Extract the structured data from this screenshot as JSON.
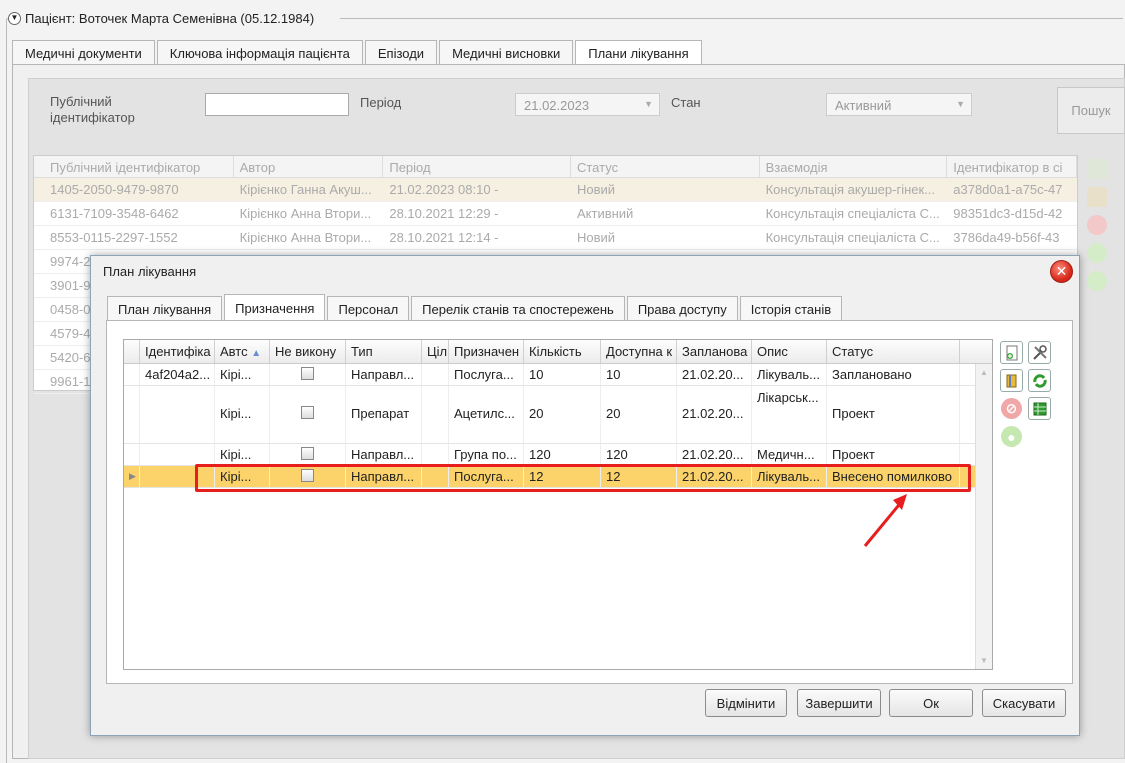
{
  "patient_header": {
    "title": "Пацієнт: Вοточек Марта Семенівна (05.12.1984)",
    "toggle_icon": "chevron-down-icon"
  },
  "main_tabs": [
    {
      "label": "Медичні документи",
      "active": false
    },
    {
      "label": "Ключова інформація пацієнта",
      "active": false
    },
    {
      "label": "Епізоди",
      "active": false
    },
    {
      "label": "Медичні висновки",
      "active": false
    },
    {
      "label": "Плани лікування",
      "active": true
    }
  ],
  "filters": {
    "public_id_label": "Публічний ідентифікатор",
    "public_id_value": "",
    "period_label": "Період",
    "period_value": "21.02.2023",
    "state_label": "Стан",
    "state_value": "Активний",
    "search_label": "Пошук"
  },
  "plans_grid": {
    "columns": [
      "Публічний ідентифікатор",
      "Автор",
      "Період",
      "Статус",
      "Взаємодія",
      "Ідентифікатор в сі"
    ],
    "rows": [
      [
        "1405-2050-9479-9870",
        "Кірієнко Ганна Акуш...",
        "21.02.2023 08:10 -",
        "Новий",
        "Консультація акушер-гінек...",
        "a378d0a1-a75c-47"
      ],
      [
        "6131-7109-3548-6462",
        "Кірієнко Анна Втори...",
        "28.10.2021 12:29 -",
        "Активний",
        "Консультація спеціаліста С...",
        "98351dc3-d15d-42"
      ],
      [
        "8553-0115-2297-1552",
        "Кірієнко Анна Втори...",
        "28.10.2021 12:14 -",
        "Новий",
        "Консультація спеціаліста С...",
        "3786da49-b56f-43"
      ],
      [
        "9974-2",
        "",
        "",
        "",
        "",
        ""
      ],
      [
        "3901-9",
        "",
        "",
        "",
        "",
        ""
      ],
      [
        "0458-0",
        "",
        "",
        "",
        "",
        ""
      ],
      [
        "4579-4",
        "",
        "",
        "",
        "",
        ""
      ],
      [
        "5420-6",
        "",
        "",
        "",
        "",
        ""
      ],
      [
        "9961-1",
        "",
        "",
        "",
        "",
        ""
      ]
    ]
  },
  "dialog": {
    "title": "План лікування",
    "tabs": [
      {
        "label": "План лікування",
        "active": false
      },
      {
        "label": "Призначення",
        "active": true
      },
      {
        "label": "Персонал",
        "active": false
      },
      {
        "label": "Перелік станів та спостережень",
        "active": false
      },
      {
        "label": "Права доступу",
        "active": false
      },
      {
        "label": "Історія станів",
        "active": false
      }
    ],
    "grid": {
      "columns": [
        "Ідентифіка",
        "Автс",
        "Не викону",
        "Тип",
        "Ціл",
        "Призначен",
        "Кількість",
        "Доступна к",
        "Запланова",
        "Опис",
        "Статус"
      ],
      "rows": [
        {
          "id": "4af204a2...",
          "author": "Кірі...",
          "type": "Направл...",
          "goal": "",
          "assigned": "Послуга...",
          "qty": "10",
          "avail": "10",
          "planned": "21.02.20...",
          "desc": "Лікуваль...",
          "status": "Заплановано"
        },
        {
          "id": "",
          "author": "Кірі...",
          "type": "Препарат",
          "goal": "",
          "assigned": "Ацетилс...",
          "qty": "20",
          "avail": "20",
          "planned": "21.02.20...",
          "desc": "Лікарськ...",
          "status": "Проект"
        },
        {
          "id": "",
          "author": "Кірі...",
          "type": "Направл...",
          "goal": "",
          "assigned": "Група по...",
          "qty": "120",
          "avail": "120",
          "planned": "21.02.20...",
          "desc": "Медичн...",
          "status": "Проект"
        },
        {
          "id": "",
          "author": "Кірі...",
          "type": "Направл...",
          "goal": "",
          "assigned": "Послуга...",
          "qty": "12",
          "avail": "12",
          "planned": "21.02.20...",
          "desc": "Лікуваль...",
          "status": "Внесено помилково"
        }
      ]
    },
    "buttons": {
      "revoke": "Відмінити",
      "complete": "Завершити",
      "ok": "Ок",
      "cancel": "Скасувати"
    }
  },
  "colors": {
    "selected_row": "#fbd36a",
    "highlight": "#e61e1e",
    "close": "#d62718"
  }
}
